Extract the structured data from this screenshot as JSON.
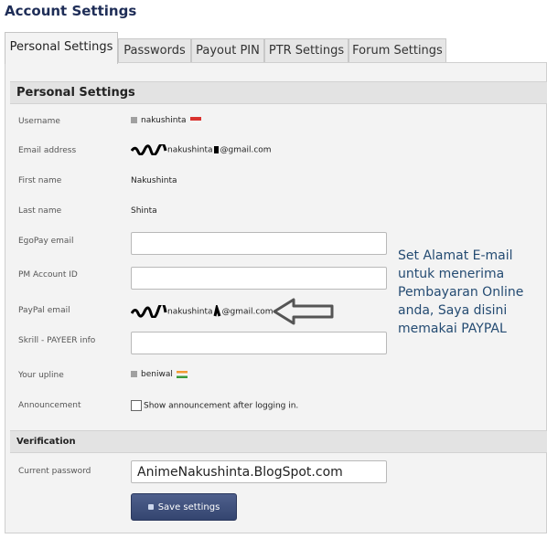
{
  "page_title": "Account Settings",
  "tabs": [
    {
      "label": "Personal Settings",
      "active": true
    },
    {
      "label": "Passwords"
    },
    {
      "label": "Payout PIN"
    },
    {
      "label": "PTR Settings"
    },
    {
      "label": "Forum Settings"
    }
  ],
  "personal": {
    "heading": "Personal Settings",
    "fields": {
      "username": {
        "label": "Username",
        "value": "nakushinta"
      },
      "email": {
        "label": "Email address",
        "value_mid": "nakushinta",
        "value_end": "@gmail.com"
      },
      "first_name": {
        "label": "First name",
        "value": "Nakushinta"
      },
      "last_name": {
        "label": "Last name",
        "value": "Shinta"
      },
      "egopay": {
        "label": "EgoPay email",
        "value": ""
      },
      "pm_account": {
        "label": "PM Account ID",
        "value": ""
      },
      "paypal": {
        "label": "PayPal email",
        "value_mid": "nakushinta",
        "value_end": "@gmail.com"
      },
      "skrill": {
        "label": "Skrill - PAYEER info",
        "value": ""
      },
      "upline": {
        "label": "Your upline",
        "value": "beniwal"
      },
      "announcement": {
        "label": "Announcement",
        "checkbox_label": "Show announcement after logging in.",
        "checked": false
      }
    }
  },
  "verification": {
    "heading": "Verification",
    "current_password_label": "Current password",
    "current_password_value": "AnimeNakushinta.BlogSpot.com",
    "save_label": "Save settings"
  },
  "annotation": {
    "text": "Set Alamat E-mail untuk menerima Pembayaran Online anda, Saya disini memakai PAYPAL",
    "arrow_icon": "left-arrow-outline-icon"
  },
  "colors": {
    "title": "#1e2d57",
    "button": "#3d4e7a",
    "note": "#244b72"
  }
}
